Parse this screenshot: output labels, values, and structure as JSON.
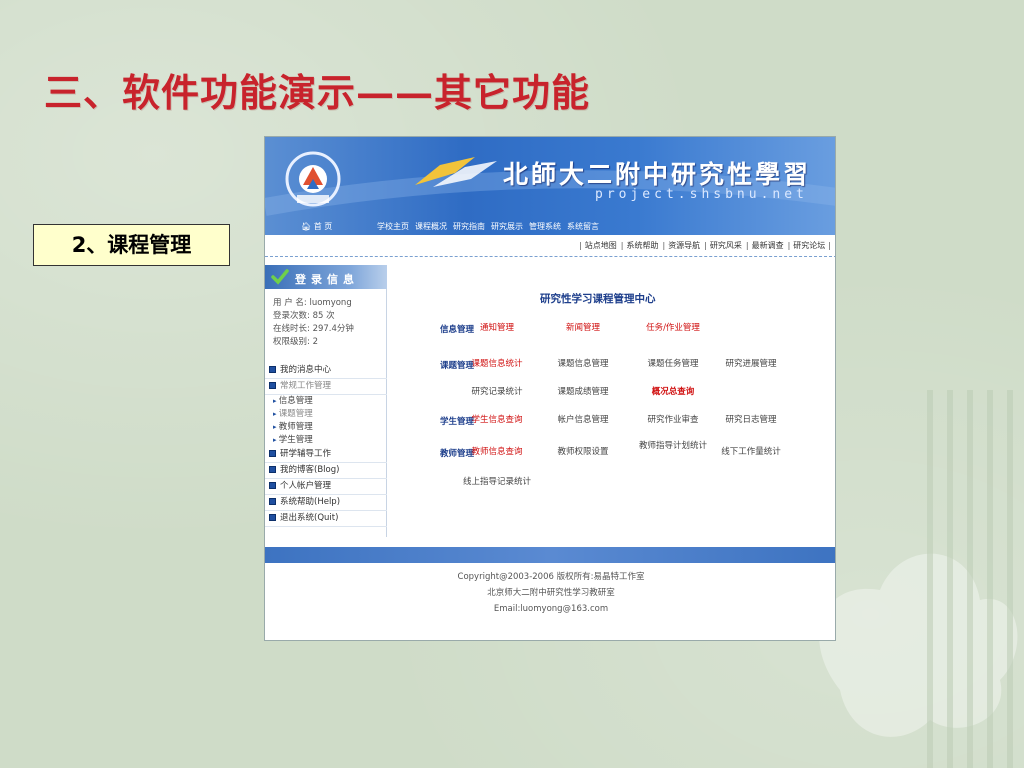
{
  "slide": {
    "title": "三、软件功能演示——其它功能",
    "section_label": "2、课程管理"
  },
  "site": {
    "title": "北師大二附中研究性學習",
    "url": "project.shsbnu.net",
    "home": "首 页",
    "topnav": [
      "学校主页",
      "课程概况",
      "研究指南",
      "研究展示",
      "管理系统",
      "系统留言"
    ],
    "subnav": [
      "站点地图",
      "系统帮助",
      "资源导航",
      "研究风采",
      "最新调查",
      "研究论坛"
    ]
  },
  "sidebar": {
    "login_title": "登录信息",
    "user": "用 户 名: luomyong",
    "logins": "登录次数: 85 次",
    "online": "在线时长: 297.4分钟",
    "level": "权限级别: 2",
    "menu": [
      {
        "label": "我的消息中心",
        "type": "item",
        "gray": false
      },
      {
        "label": "常规工作管理",
        "type": "item",
        "gray": true
      },
      {
        "label": "信息管理",
        "type": "sub",
        "gray": false
      },
      {
        "label": "课题管理",
        "type": "sub",
        "gray": true
      },
      {
        "label": "教师管理",
        "type": "sub",
        "gray": false
      },
      {
        "label": "学生管理",
        "type": "sub",
        "gray": false
      },
      {
        "label": "研学辅导工作",
        "type": "item",
        "gray": false
      },
      {
        "label": "我的博客(Blog)",
        "type": "item",
        "gray": false
      },
      {
        "label": "个人帐户管理",
        "type": "item",
        "gray": false
      },
      {
        "label": "系统帮助(Help)",
        "type": "item",
        "gray": false
      },
      {
        "label": "退出系统(Quit)",
        "type": "item",
        "gray": false
      }
    ]
  },
  "main": {
    "title": "研究性学习课程管理中心",
    "rows": [
      {
        "label": "信息管理",
        "cells": [
          {
            "text": "通知管理",
            "red": true,
            "bold": false
          },
          {
            "text": "新闻管理",
            "red": true,
            "bold": false
          },
          {
            "text": "任务/作业管理",
            "red": true,
            "bold": false
          }
        ]
      },
      {
        "label": "课题管理",
        "cells": [
          {
            "text": "课题信息统计",
            "red": true,
            "bold": false
          },
          {
            "text": "课题信息管理",
            "red": false,
            "bold": false
          },
          {
            "text": "课题任务管理",
            "red": false,
            "bold": false
          },
          {
            "text": "研究进展管理",
            "red": false,
            "bold": false
          }
        ]
      },
      {
        "label": "",
        "cells": [
          {
            "text": "研究记录统计",
            "red": false,
            "bold": false
          },
          {
            "text": "课题成绩管理",
            "red": false,
            "bold": false
          },
          {
            "text": "概况总查询",
            "red": true,
            "bold": true
          }
        ]
      },
      {
        "label": "学生管理",
        "cells": [
          {
            "text": "学生信息查询",
            "red": true,
            "bold": false
          },
          {
            "text": "帐户信息管理",
            "red": false,
            "bold": false
          },
          {
            "text": "研究作业审查",
            "red": false,
            "bold": false
          },
          {
            "text": "研究日志管理",
            "red": false,
            "bold": false
          }
        ]
      },
      {
        "label": "教师管理",
        "cells": [
          {
            "text": "教师信息查询",
            "red": true,
            "bold": false
          },
          {
            "text": "教师权限设置",
            "red": false,
            "bold": false
          },
          {
            "text": "教师指导计划统计",
            "red": false,
            "bold": false
          },
          {
            "text": "线下工作量统计",
            "red": false,
            "bold": false
          }
        ]
      },
      {
        "label": "",
        "cells": [
          {
            "text": "线上指导记录统计",
            "red": false,
            "bold": false
          }
        ]
      }
    ]
  },
  "footer": {
    "copyright": "Copyright@2003-2006 版权所有:易晶特工作室",
    "org": "北京师大二附中研究性学习教研室",
    "email": "Email:luomyong@163.com"
  },
  "colors": {
    "slide_bg": "#cfdcc8",
    "title_red": "#c8232c",
    "banner_blue": "#2f6cc4",
    "label_navy": "#1e3f8c",
    "link_red": "#d01010"
  }
}
